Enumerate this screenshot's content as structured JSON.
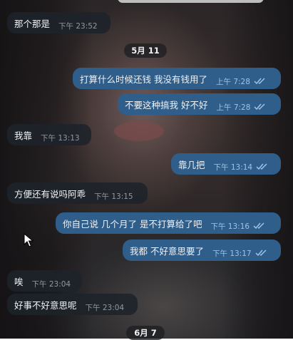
{
  "messages": [
    {
      "dir": "in",
      "text": "那个那是",
      "time": "下午 23:52"
    },
    {
      "dir": "out",
      "text": "打算什么时候还钱 我没有钱用了",
      "time": "上午 7:28",
      "read": true
    },
    {
      "dir": "out",
      "text": "不要这种搞我 好不好",
      "time": "上午 7:28",
      "read": true
    },
    {
      "dir": "in",
      "text": "我靠",
      "time": "下午 13:13"
    },
    {
      "dir": "out",
      "text": "靠几把",
      "time": "下午 13:14",
      "read": true
    },
    {
      "dir": "in",
      "text": "方便还有说吗阿乖",
      "time": "下午 13:15"
    },
    {
      "dir": "out",
      "text": "你自己说 几个月了 是不打算给了吧",
      "time": "下午 13:16",
      "read": true
    },
    {
      "dir": "out",
      "text": "我都 不好意思要了",
      "time": "下午 13:17",
      "read": true
    },
    {
      "dir": "in",
      "text": "唉",
      "time": "下午 23:04"
    },
    {
      "dir": "in",
      "text": "好事不好意思呢",
      "time": "下午 23:04"
    }
  ],
  "date_separators": [
    {
      "label": "5月 11"
    },
    {
      "label": "6月 7"
    }
  ],
  "colors": {
    "outgoing_bubble": "#2f5e8b",
    "incoming_bubble": "#1e232a",
    "read_check": "#9ec3e6"
  },
  "icons": {
    "read_status": "double-check-icon",
    "cursor": "mouse-pointer-icon"
  }
}
